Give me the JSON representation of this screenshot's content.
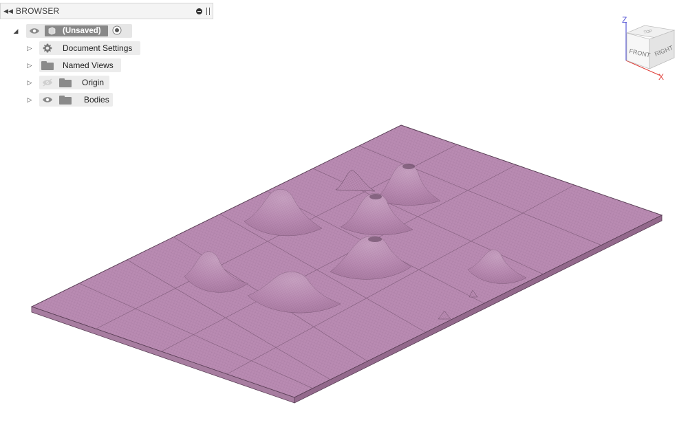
{
  "browser": {
    "title": "BROWSER",
    "collapse_icon": "double-left-arrow-icon",
    "root": {
      "name": "(Unsaved)",
      "expanded": true
    },
    "items": [
      {
        "label": "Document Settings",
        "icon": "gear-icon"
      },
      {
        "label": "Named Views",
        "icon": "folder-icon"
      },
      {
        "label": "Origin",
        "icon": "folder-icon",
        "visibility": "hidden"
      },
      {
        "label": "Bodies",
        "icon": "folder-icon",
        "visibility": "visible"
      }
    ]
  },
  "viewcube": {
    "face_front": "FRONT",
    "face_right": "RIGHT",
    "face_top": "TOP",
    "axis_z": "Z",
    "axis_x": "X",
    "axis_z_color": "#5b5bd6",
    "axis_x_color": "#e0403a"
  },
  "model": {
    "surface_color": "#b98bb2",
    "edge_color": "#4a3348"
  }
}
